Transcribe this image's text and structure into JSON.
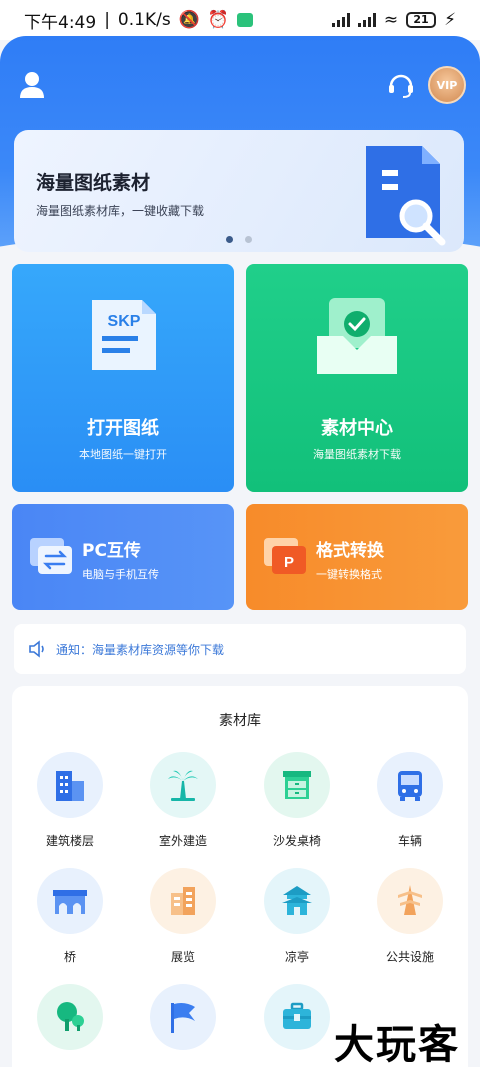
{
  "status_bar": {
    "time": "下午4:49",
    "speed": "0.1K/s",
    "battery": "21"
  },
  "header": {
    "icons": [
      "user-icon",
      "headset-icon",
      "vip-icon"
    ],
    "vip_label": "VIP"
  },
  "banner": {
    "title": "海量图纸素材",
    "subtitle": "海量图纸素材库，一键收藏下载",
    "active_slide": 1,
    "slide_count": 2
  },
  "tiles": {
    "open": {
      "title": "打开图纸",
      "subtitle": "本地图纸一键打开",
      "badge": "SKP",
      "color": "#2f98f8"
    },
    "library": {
      "title": "素材中心",
      "subtitle": "海量图纸素材下载",
      "color": "#18c882"
    },
    "pc": {
      "title": "PC互传",
      "subtitle": "电脑与手机互传",
      "color": "#4f8df6"
    },
    "format": {
      "title": "格式转换",
      "subtitle": "一键转换格式",
      "badge": "P",
      "color": "#f8922f"
    }
  },
  "notice": {
    "text": "通知：海量素材库资源等你下载"
  },
  "library": {
    "title": "素材库",
    "categories": [
      {
        "label": "建筑楼层",
        "icon": "building-icon"
      },
      {
        "label": "室外建造",
        "icon": "palm-tree-icon"
      },
      {
        "label": "沙发桌椅",
        "icon": "cabinet-icon"
      },
      {
        "label": "车辆",
        "icon": "bus-icon"
      },
      {
        "label": "桥",
        "icon": "bridge-icon"
      },
      {
        "label": "展览",
        "icon": "exhibition-icon"
      },
      {
        "label": "凉亭",
        "icon": "pavilion-icon"
      },
      {
        "label": "公共设施",
        "icon": "tower-icon"
      },
      {
        "label": "",
        "icon": "tree-icon"
      },
      {
        "label": "",
        "icon": "flag-icon"
      },
      {
        "label": "",
        "icon": "toolbox-icon"
      }
    ]
  },
  "watermark": "大玩客"
}
